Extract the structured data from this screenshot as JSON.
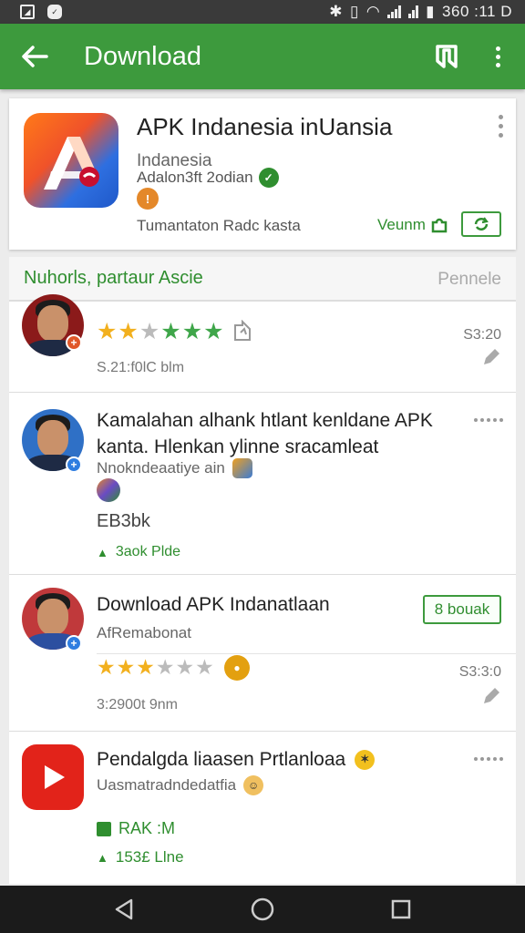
{
  "status_bar": {
    "time": "360 :11 D"
  },
  "app_bar": {
    "title": "Download"
  },
  "app": {
    "name": "APK Indanesia inUansia",
    "developer": "Indanesia",
    "meta": "Adalon3ft 2odian",
    "badge": "!",
    "description": "Tumantaton Radc kasta",
    "version_label": "Veunm"
  },
  "section": {
    "title": "Nuhorls, partaur Ascie",
    "action": "Pennele"
  },
  "reviews": [
    {
      "meta": "S.21:f0lC  blm",
      "date": "S3:20",
      "rating": 3
    },
    {
      "title": "Kamalahan alhank htlant kenldane APK kanta. Hlenkan ylinne sracamleat",
      "subtitle": "Nnokndeaatiye ain",
      "count": "EB3bk",
      "footer": "3aok Plde"
    },
    {
      "title": "Download APK Indanatlaan",
      "button": "8 bouak",
      "subtitle": "AfRemabonat",
      "date": "S3:3:0",
      "meta": "3:2900t  9nm",
      "rating": 3
    },
    {
      "title": "Pendalgda liaasen Prtlanloaa",
      "subtitle": "Uasmatradndedatfia",
      "tag": "RAK :M",
      "footer": "153£ Llne"
    }
  ],
  "colors": {
    "accent": "#3d9a3d",
    "star": "#f2b01e",
    "star_alt": "#3fa64a"
  }
}
